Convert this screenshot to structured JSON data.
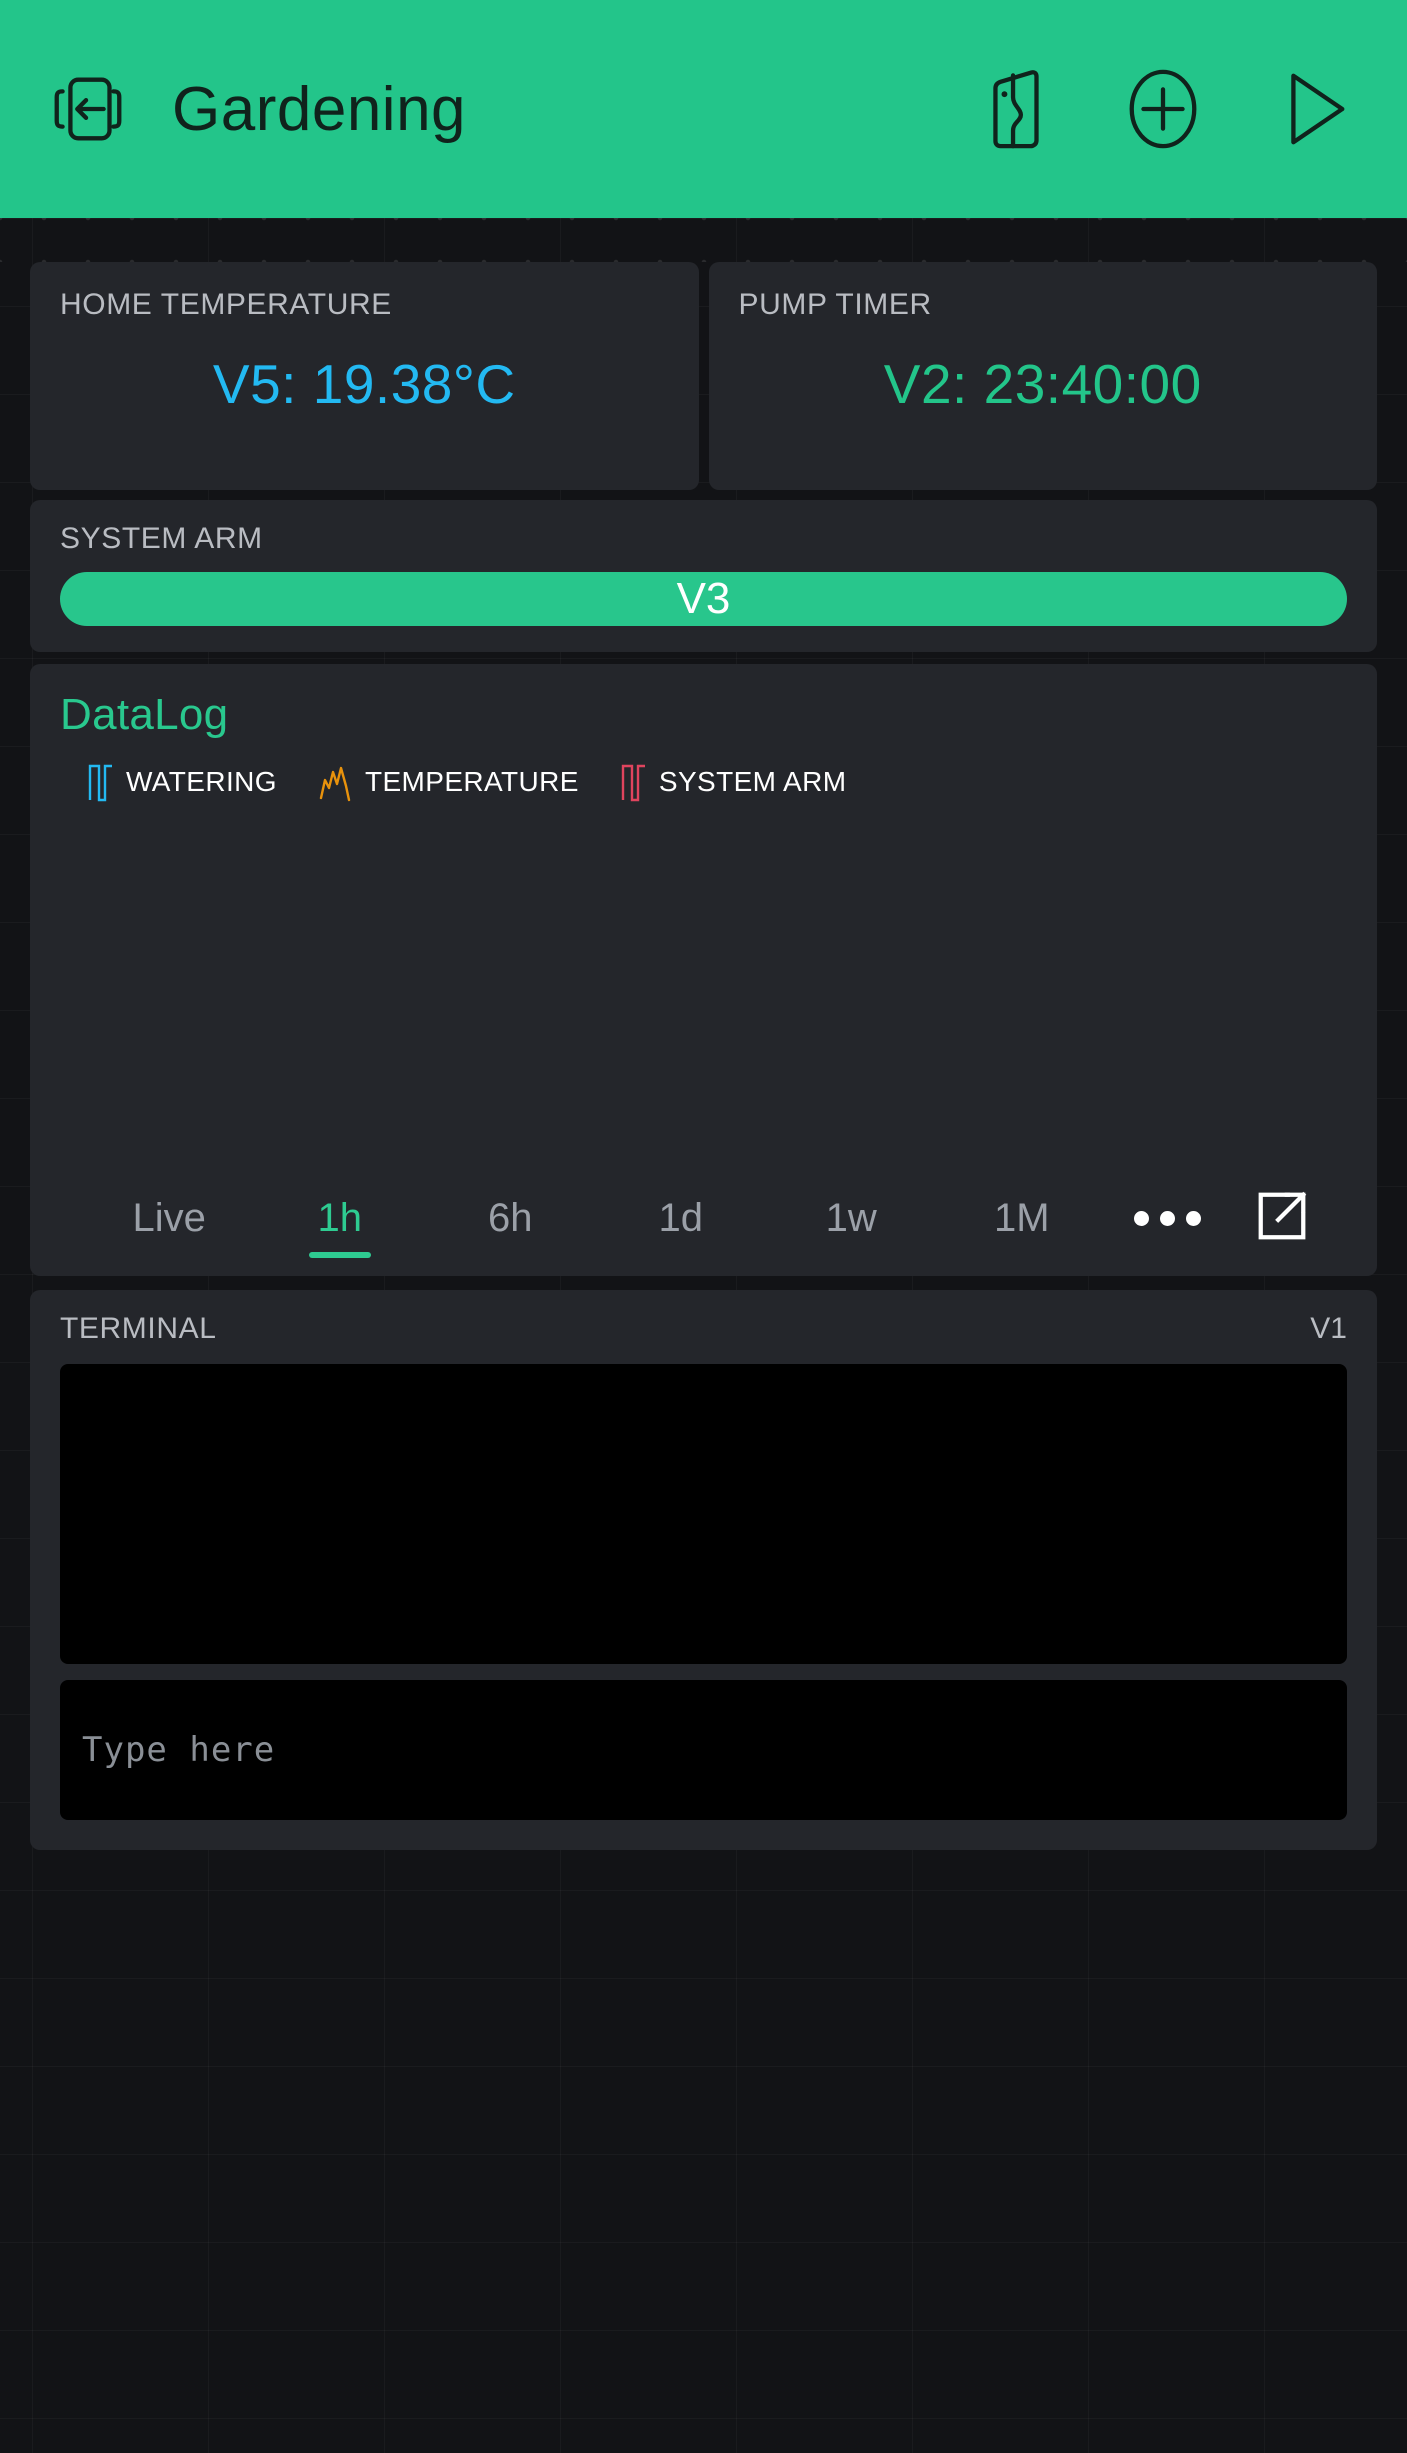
{
  "header": {
    "title": "Gardening",
    "back_icon": "device-back-arrow-icon",
    "device_icon": "phone-device-icon",
    "add_icon": "plus-circle-icon",
    "play_icon": "play-triangle-icon",
    "background_color": "#23c58a",
    "foreground_color": "#10231c"
  },
  "widgets": {
    "home_temperature": {
      "label": "HOME TEMPERATURE",
      "value": "V5: 19.38°C",
      "value_color": "#23b9f2"
    },
    "pump_timer": {
      "label": "PUMP TIMER",
      "value": "V2: 23:40:00",
      "value_color": "#23c58a"
    },
    "system_arm": {
      "label": "SYSTEM ARM",
      "button_label": "V3",
      "button_color": "#28c68c"
    },
    "datalog": {
      "title": "DataLog",
      "legend": [
        {
          "label": "WATERING",
          "color": "#23b9f2",
          "icon": "square-wave-icon"
        },
        {
          "label": "TEMPERATURE",
          "color": "#e8920c",
          "icon": "line-chart-icon"
        },
        {
          "label": "SYSTEM ARM",
          "color": "#e0445e",
          "icon": "square-wave-icon"
        }
      ],
      "tabs": [
        {
          "label": "Live",
          "active": false
        },
        {
          "label": "1h",
          "active": true
        },
        {
          "label": "6h",
          "active": false
        },
        {
          "label": "1d",
          "active": false
        },
        {
          "label": "1w",
          "active": false
        },
        {
          "label": "1M",
          "active": false
        }
      ],
      "more_icon": "ellipsis-icon",
      "export_icon": "external-link-icon",
      "active_tab_color": "#2ecb91"
    },
    "terminal": {
      "label": "TERMINAL",
      "pin": "V1",
      "console_text": "",
      "input_value": "",
      "input_placeholder": "Type here"
    }
  },
  "chart_data": {
    "type": "line",
    "title": "DataLog",
    "series": [
      {
        "name": "WATERING",
        "color": "#23b9f2",
        "values": []
      },
      {
        "name": "TEMPERATURE",
        "color": "#e8920c",
        "values": []
      },
      {
        "name": "SYSTEM ARM",
        "color": "#e0445e",
        "values": []
      }
    ],
    "x": [],
    "xlabel": "",
    "ylabel": "",
    "time_range": "1h",
    "grid": false,
    "legend_position": "top",
    "note": "chart plot area is empty — no data rendered"
  }
}
